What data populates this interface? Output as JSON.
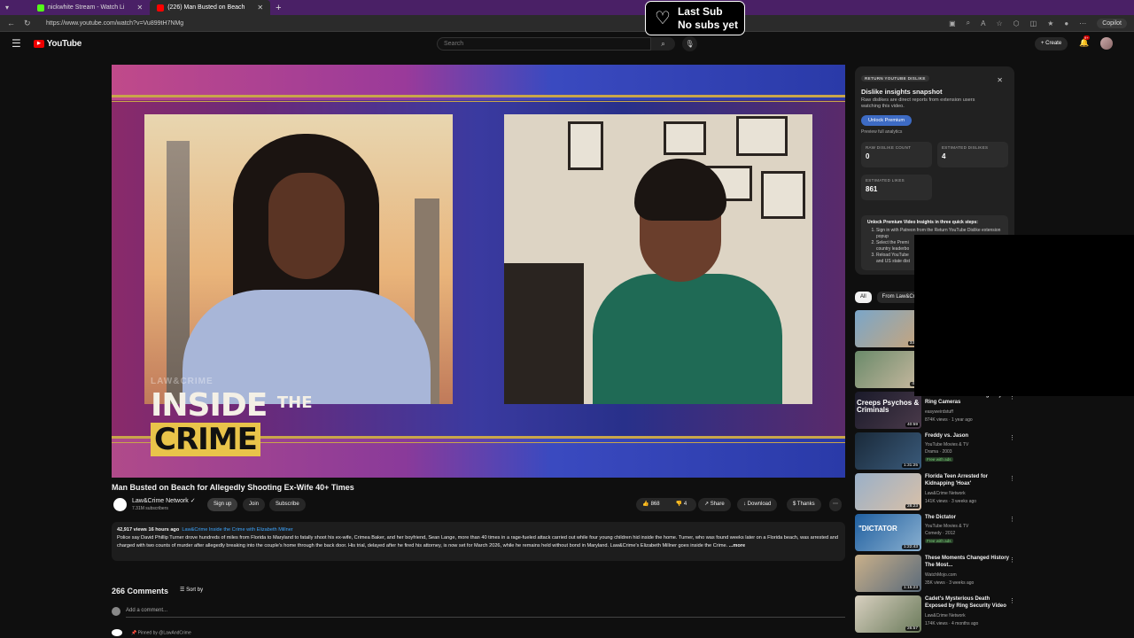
{
  "browser": {
    "tabs": [
      {
        "label": "nickwhite Stream - Watch Li"
      },
      {
        "label": "(226) Man Busted on Beach"
      }
    ],
    "url": "https://www.youtube.com/watch?v=Vu899tH7NMg",
    "copilot": "Copilot"
  },
  "overlay": {
    "line1": "Last Sub",
    "line2": "No subs yet"
  },
  "header": {
    "logo": "YouTube",
    "search_placeholder": "Search",
    "create_label": "Create",
    "notif_count": "9+"
  },
  "player": {
    "brand": "LAW&CRIME",
    "title_line1": "INSIDE",
    "title_the": "THE",
    "title_line2": "CRIME"
  },
  "video": {
    "title": "Man Busted on Beach for Allegedly Shooting Ex-Wife 40+ Times",
    "channel": "Law&Crime Network",
    "subscribers": "7.31M subscribers",
    "signup": "Sign up",
    "join": "Join",
    "subscribe": "Subscribe",
    "likes": "868",
    "dislikes": "4",
    "share": "Share",
    "download": "Download",
    "thanks": "Thanks",
    "views_time": "42,917 views  16 hours ago",
    "hashtag": "Law&Crime Inside the Crime with Elizabeth Millner",
    "description": "Police say David Phillip Turner drove hundreds of miles from Florida to Maryland to fatally shoot his ex-wife, Crimea Baker, and her boyfriend, Sean Lange, more than 40 times in a rage-fueled attack carried out while four young children hid inside the home. Turner, who was found weeks later on a Florida beach, was arrested and charged with two counts of murder after allegedly breaking into the couple's home through the back door. His trial, delayed after he fired his attorney, is now set for March 2026, while he remains held without bond in Maryland. Law&Crime's Elizabeth Millner goes inside the Crime.",
    "more": "...more"
  },
  "comments": {
    "count": "266 Comments",
    "sort": "Sort by",
    "add": "Add a comment...",
    "pinned": "Pinned by @LawAndCrime"
  },
  "dislike_panel": {
    "badge": "RETURN YOUTUBE DISLIKE",
    "title": "Dislike insights snapshot",
    "desc": "Raw dislikes are direct reports from extension users watching this video.",
    "unlock": "Unlock Premium",
    "preview": "Preview full analytics",
    "raw_label": "RAW DISLIKE COUNT",
    "raw_value": "0",
    "est_dislikes_label": "ESTIMATED DISLIKES",
    "est_dislikes_value": "4",
    "est_likes_label": "ESTIMATED LIKES",
    "est_likes_value": "861",
    "steps_title": "Unlock Premium Video Insights in three quick steps:",
    "step1": "Sign in with Patreon from the Return YouTube Dislike extension popup",
    "step2": "Select the Premi",
    "step2b": "country leaderbo",
    "step3": "Reload YouTube",
    "step3b": "and US state dist"
  },
  "chips": [
    "All",
    "From Law&Cri"
  ],
  "recommendations": [
    {
      "title": "",
      "channel": "",
      "meta": "",
      "duration": "33:1"
    },
    {
      "title": "",
      "channel": "",
      "meta": "",
      "duration": "42:"
    },
    {
      "title": "Dashcam Criminals Caught by Ring Cameras",
      "channel": "easyweirdstuff",
      "meta": "874K views · 1 year ago",
      "duration": "40:59",
      "thumb_text": "Creeps Psychos & Criminals"
    },
    {
      "title": "Freddy vs. Jason",
      "channel": "YouTube Movies & TV",
      "meta": "Drama · 2003",
      "free": "Free with ads",
      "duration": "1:31:25"
    },
    {
      "title": "Florida Teen Arrested for Kidnapping 'Hoax'",
      "channel": "Law&Crime Network",
      "meta": "141K views · 3 weeks ago",
      "duration": "28:23"
    },
    {
      "title": "The Dictator",
      "channel": "YouTube Movies & TV",
      "meta": "Comedy · 2012",
      "free": "Free with ads",
      "duration": "1:22:43",
      "thumb_text": "\"DICTATOR"
    },
    {
      "title": "These Moments Changed History The Most...",
      "channel": "WatchMojo.com",
      "meta": "35K views · 3 weeks ago",
      "duration": "1:15:23"
    },
    {
      "title": "Cadet's Mysterious Death Exposed by Ring Security Video",
      "channel": "Law&Crime Network",
      "meta": "174K views · 4 months ago",
      "duration": "26:57"
    }
  ]
}
